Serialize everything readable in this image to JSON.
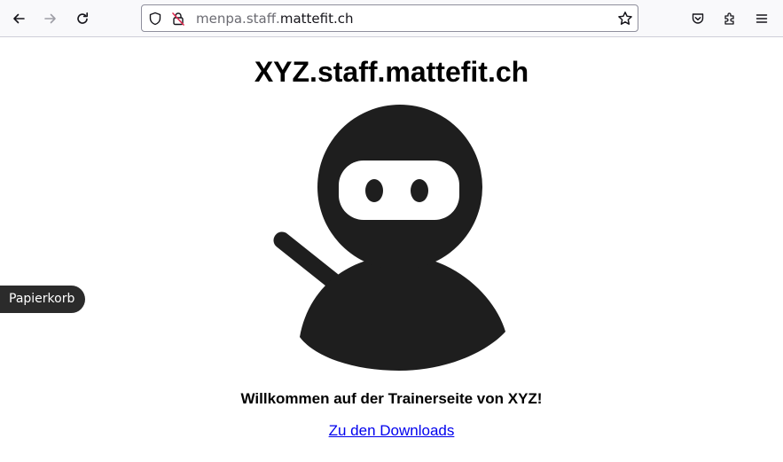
{
  "browser": {
    "url_subdomain": "menpa.staff.",
    "url_host": "mattefit.ch",
    "icons": {
      "back": "arrow-left-icon",
      "forward": "arrow-right-icon",
      "reload": "reload-icon",
      "tracking": "shield-icon",
      "connection": "insecure-lock-icon",
      "bookmark": "star-icon",
      "pocket": "pocket-icon",
      "extensions": "puzzle-icon",
      "menu": "hamburger-menu-icon"
    }
  },
  "page": {
    "title": "XYZ.staff.mattefit.ch",
    "welcome": "Willkommen auf der Trainerseite von XYZ!",
    "downloads_link": "Zu den Downloads",
    "image": "ninja-mascot",
    "link_color": "#0000ee"
  },
  "desktop": {
    "tooltip": "Papierkorb"
  }
}
